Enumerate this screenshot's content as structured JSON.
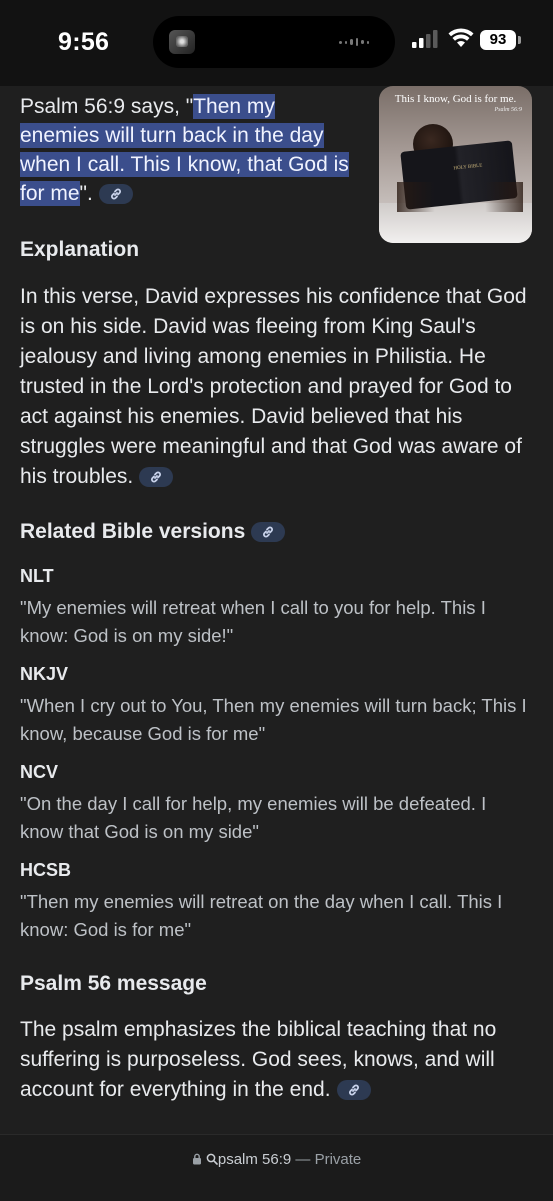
{
  "status": {
    "time": "9:56",
    "battery": "93"
  },
  "answer": {
    "verse_prefix": "Psalm 56:9 says, \"",
    "verse_highlight": "Then my enemies will turn back in the day when I call. This I know, that God is for me",
    "verse_suffix": "\".",
    "image_caption": "This I know, God is for me.",
    "image_sub": "Psalm 56:9",
    "image_book_label": "HOLY BIBLE"
  },
  "explanation": {
    "heading": "Explanation",
    "body": "In this verse, David expresses his confidence that God is on his side. David was fleeing from King Saul's jealousy and living among enemies in Philistia. He trusted in the Lord's protection and prayed for God to act against his enemies. David believed that his struggles were meaningful and that God was aware of his troubles."
  },
  "versions": {
    "heading": "Related Bible versions",
    "items": [
      {
        "label": "NLT",
        "quote": "\"My enemies will retreat when I call to you for help. This I know: God is on my side!\""
      },
      {
        "label": "NKJV",
        "quote": "\"When I cry out to You, Then my enemies will turn back; This I know, because God is for me\""
      },
      {
        "label": "NCV",
        "quote": "\"On the day I call for help, my enemies will be defeated. I know that God is on my side\""
      },
      {
        "label": "HCSB",
        "quote": "\"Then my enemies will retreat on the day when I call. This I know: God is for me\""
      }
    ]
  },
  "message": {
    "heading": "Psalm 56 message",
    "body": "The psalm emphasizes the biblical teaching that no suffering is purposeless. God sees, knows, and will account for everything in the end."
  },
  "address_bar": {
    "query": "psalm 56:9",
    "separator": "—",
    "mode": "Private"
  },
  "colors": {
    "background": "#1f1f1f",
    "highlight": "#3b4e8c",
    "link_chip": "#2d3a52"
  }
}
